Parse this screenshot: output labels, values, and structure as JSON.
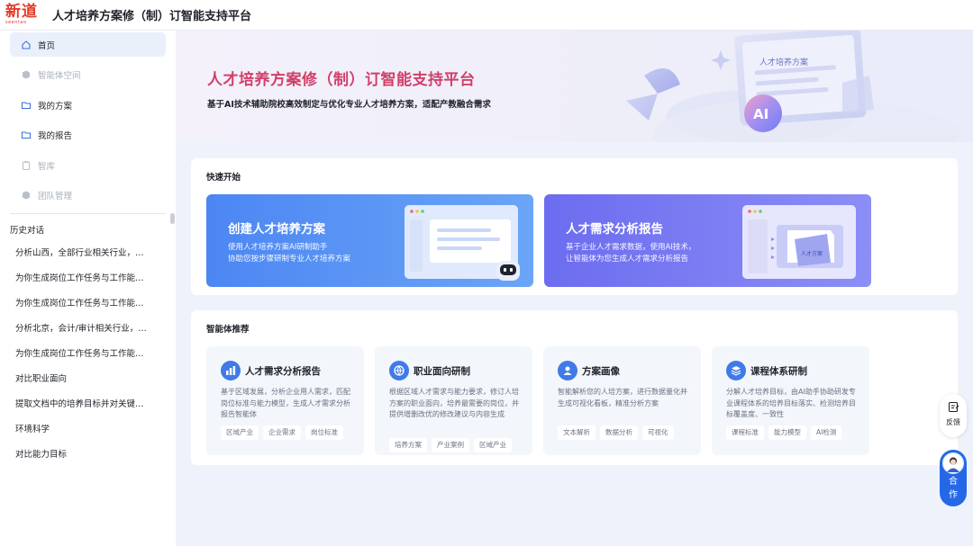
{
  "header": {
    "logo_main": "新道",
    "logo_sub": "seentao",
    "title": "人才培养方案修（制）订智能支持平台"
  },
  "sidebar": {
    "nav": [
      {
        "label": "首页",
        "icon": "home-icon",
        "active": true
      },
      {
        "label": "智能体空间",
        "icon": "cube-icon",
        "disabled": true
      },
      {
        "label": "我的方案",
        "icon": "folder-icon"
      },
      {
        "label": "我的报告",
        "icon": "folder-icon"
      },
      {
        "label": "智库",
        "icon": "clipboard-icon",
        "disabled": true
      },
      {
        "label": "团队管理",
        "icon": "cube-icon",
        "disabled": true
      }
    ],
    "history_title": "历史对话",
    "history": [
      "分析山西，全部行业相关行业，…",
      "为你生成岗位工作任务与工作能…",
      "为你生成岗位工作任务与工作能…",
      "分析北京，会计/审计相关行业，…",
      "为你生成岗位工作任务与工作能…",
      "对比职业面向",
      "提取文档中的培养目标并对关键…",
      "环境科学",
      "对比能力目标"
    ]
  },
  "banner": {
    "title": "人才培养方案修（制）订智能支持平台",
    "subtitle": "基于AI技术辅助院校高效制定与优化专业人才培养方案，适配产教融合需求",
    "illus_label": "人才培养方案",
    "illus_ai": "AI"
  },
  "quick_start": {
    "title": "快速开始",
    "tiles": [
      {
        "title": "创建人才培养方案",
        "desc1": "使用人才培养方案AI研制助手",
        "desc2": "协助您按步骤研制专业人才培养方案"
      },
      {
        "title": "人才需求分析报告",
        "desc1": "基于企业人才需求数据，使用AI技术，",
        "desc2": "让智能体为您生成人才需求分析报告",
        "illus_label": "人才方案"
      }
    ]
  },
  "agents": {
    "title": "智能体推荐",
    "items": [
      {
        "name": "人才需求分析报告",
        "icon": "chart-icon",
        "desc": "基于区域发展，分析企业用人需求，匹配岗位标准与能力模型，生成人才需求分析报告智能体",
        "tags": [
          "区域产业",
          "企业需求",
          "岗位标准"
        ]
      },
      {
        "name": "职业面向研制",
        "icon": "globe-icon",
        "desc": "根据区域人才需求与能力要求，修订人培方案的职业面向，培养最需要的岗位，并提供增删改优的修改建议与内容生成",
        "tags": [
          "培养方案",
          "产业案例",
          "区域产业"
        ]
      },
      {
        "name": "方案画像",
        "icon": "portrait-icon",
        "desc": "智能解析您的人培方案，进行数据量化并生成可视化看板，精准分析方案",
        "tags": [
          "文本解析",
          "数据分析",
          "可视化"
        ]
      },
      {
        "name": "课程体系研制",
        "icon": "layers-icon",
        "desc": "分解人才培养目标，由AI助手协助研发专业课程体系的培养目标落实、检测培养目标覆盖度、一致性",
        "tags": [
          "课程标准",
          "能力模型",
          "AI检测"
        ]
      }
    ]
  },
  "widgets": {
    "feedback": "反馈",
    "coop1": "合",
    "coop2": "作"
  },
  "colors": {
    "accent": "#2468e8",
    "banner_title": "#d23f69",
    "tile1": "#4c86f3",
    "tile2": "#6c6cf0"
  }
}
